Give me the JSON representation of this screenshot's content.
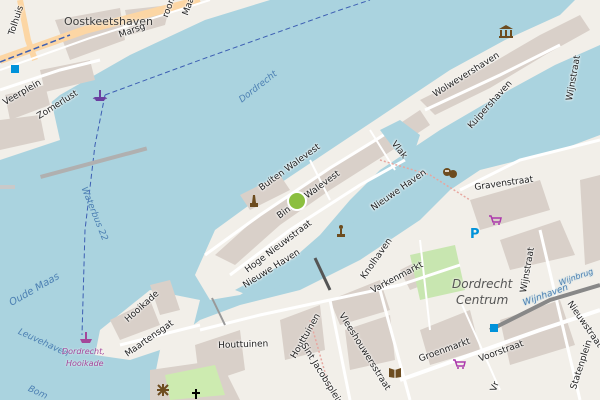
{
  "map": {
    "colors": {
      "water": "#aad3df",
      "land": "#f2efe9",
      "buildings": "#d9d0c9",
      "roads": "#ffffff",
      "primary_road": "#fcd6a4",
      "waterbus_route": "#3d5fb3",
      "marker": "#8bbf3f"
    },
    "labels": {
      "tolhuis": "Tolhuis",
      "oostkeetshaven": "Oostkeetshaven",
      "marsg": "Marsg",
      "room": "room",
      "maa": "Maa",
      "veerplein": "Veerplein",
      "zomerlust": "Zomerlust",
      "dordrecht_water": "Dordrecht",
      "waterbus": "Waterbus 22",
      "oude_maas": "Oude Maas",
      "leuvehaven": "Leuvehaven",
      "bom": "Bom",
      "buiten_walevest": "Buiten Walevest",
      "binnen_walevest": "Binnen Walevest",
      "hoge_nieuwstraat": "Hoge Nieuwstraat",
      "nieuwe_haven_1": "Nieuwe Haven",
      "nieuwe_haven_2": "Nieuwe Haven",
      "vlak": "Vlak",
      "wolwevershaven": "Wolwevershaven",
      "kuipershaven": "Kuipershaven",
      "wijnstraat_1": "Wijnstraat",
      "wijnstraat_2": "Wijnstraat",
      "gravenstraat": "Gravenstraat",
      "knolhaven": "Knolhaven",
      "varkenmarkt": "Varkenmarkt",
      "dordrecht_centrum_1": "Dordrecht",
      "dordrecht_centrum_2": "Centrum",
      "hooikade": "Hooikade",
      "maartensgat": "Maartensgat",
      "houttuinen_1": "Houttuinen",
      "houttuinen_2": "Houttuinen",
      "sint_jacobsplein": "Sint Jacobsplein",
      "vleeshouwersstraat": "Vleeshouwersstraat",
      "groenmarkt": "Groenmarkt",
      "voorstraat": "Voorstraat",
      "nieuwstraat": "Nieuwstraat",
      "statenplein": "Statenplein",
      "wijnhaven": "Wijnhaven",
      "wijnbrug": "Wijnbrug",
      "ferry_stop_1": "Dordrecht,",
      "ferry_stop_2": "Hooikade",
      "vr": "Vr"
    },
    "icons": [
      "ferry-terminal-icon",
      "ferry-terminal-icon",
      "museum-icon",
      "theatre-icon",
      "parking-icon",
      "shop-icon",
      "shop-icon",
      "library-icon",
      "monument-icon",
      "statue-icon",
      "church-icon",
      "playground-icon",
      "location-marker-icon",
      "bus-stop-icon",
      "information-icon"
    ]
  }
}
